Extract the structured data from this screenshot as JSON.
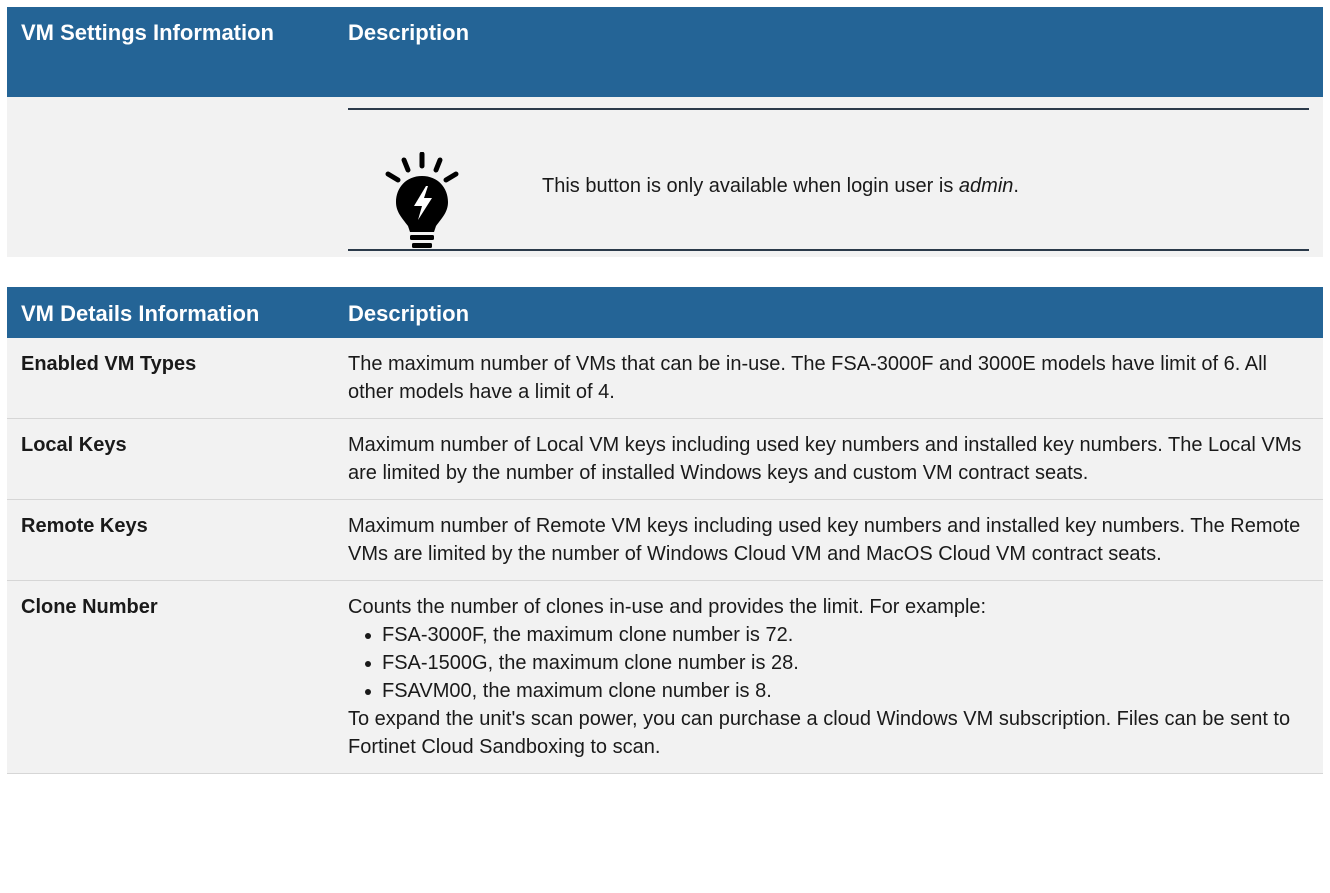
{
  "table1": {
    "header": {
      "col1": "VM Settings Information",
      "col2": "Description"
    },
    "note": {
      "icon": "lightbulb-icon",
      "text_before": "This button is only available when login user is ",
      "text_emphasis": "admin",
      "text_after": "."
    }
  },
  "table2": {
    "header": {
      "col1": "VM Details Information",
      "col2": "Description"
    },
    "rows": [
      {
        "label": "Enabled VM Types",
        "description": "The maximum number of VMs that can be in-use. The FSA-3000F and 3000E models have limit of 6. All other models have a limit of 4."
      },
      {
        "label": "Local Keys",
        "description": "Maximum number of Local VM keys including used key numbers and installed key numbers. The Local VMs are limited by the number of installed Windows keys and custom VM contract seats."
      },
      {
        "label": "Remote Keys",
        "description": "Maximum number of Remote VM keys including used key numbers and installed key numbers. The Remote VMs are limited by the number of Windows Cloud VM and MacOS Cloud VM contract seats."
      },
      {
        "label": "Clone Number",
        "description": "Counts the number of clones in-use and provides the limit. For example:",
        "bullets": [
          "FSA-3000F, the maximum clone number is 72.",
          "FSA-1500G, the maximum clone number is 28.",
          "FSAVM00, the maximum clone number is 8."
        ],
        "footer": "To expand the unit's scan power, you can purchase a cloud Windows VM subscription. Files can be sent to Fortinet Cloud Sandboxing to scan."
      }
    ]
  },
  "colors": {
    "header_bg": "#246496",
    "header_text": "#ffffff",
    "row_alt_bg": "#f2f2f2"
  }
}
